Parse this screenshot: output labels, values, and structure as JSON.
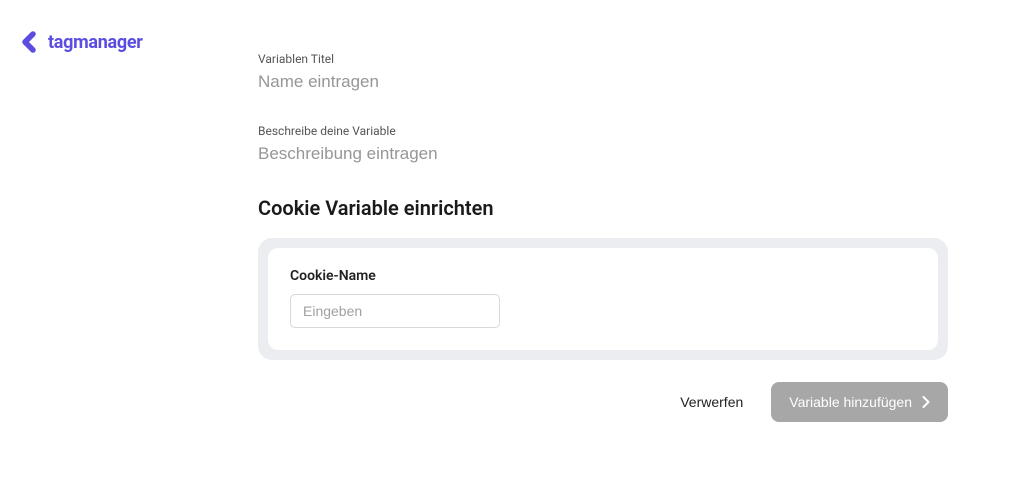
{
  "logo": {
    "text": "tagmanager"
  },
  "fields": {
    "title": {
      "label": "Variablen Titel",
      "placeholder": "Name eintragen",
      "value": ""
    },
    "description": {
      "label": "Beschreibe deine Variable",
      "placeholder": "Beschreibung eintragen",
      "value": ""
    }
  },
  "section": {
    "heading": "Cookie Variable einrichten",
    "cookie_name": {
      "label": "Cookie-Name",
      "placeholder": "Eingeben",
      "value": ""
    }
  },
  "actions": {
    "discard": "Verwerfen",
    "submit": "Variable hinzufügen"
  }
}
